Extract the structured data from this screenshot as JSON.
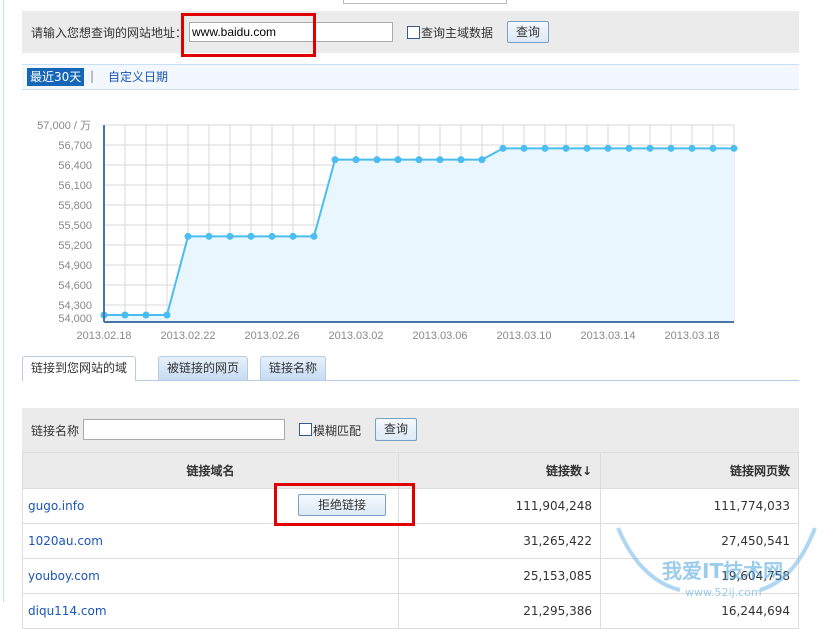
{
  "search": {
    "label": "请输入您想查询的网站地址：",
    "value": "www.baidu.com",
    "checkbox_label": "查询主域数据",
    "button": "查询"
  },
  "date_tabs": {
    "active": "最近30天",
    "separator": "|",
    "custom": "自定义日期"
  },
  "chart_data": {
    "type": "line",
    "title": "",
    "xlabel": "",
    "ylabel": "万",
    "ylim": [
      54000,
      57000
    ],
    "y_ticks": [
      "54,000",
      "54,300",
      "54,600",
      "54,900",
      "55,200",
      "55,500",
      "55,800",
      "56,100",
      "56,400",
      "56,700",
      "57,000 / 万"
    ],
    "x_ticks": [
      "2013.02.18",
      "2013.02.22",
      "2013.02.26",
      "2013.03.02",
      "2013.03.06",
      "2013.03.10",
      "2013.03.14",
      "2013.03.18"
    ],
    "x": [
      "02.18",
      "02.19",
      "02.20",
      "02.21",
      "02.22",
      "02.23",
      "02.24",
      "02.25",
      "02.26",
      "02.27",
      "02.28",
      "03.01",
      "03.02",
      "03.03",
      "03.04",
      "03.05",
      "03.06",
      "03.07",
      "03.08",
      "03.09",
      "03.10",
      "03.11",
      "03.12",
      "03.13",
      "03.14",
      "03.15",
      "03.16",
      "03.17",
      "03.18",
      "03.19",
      "03.20"
    ],
    "values": [
      54150,
      54150,
      54150,
      54150,
      55330,
      55330,
      55330,
      55330,
      55330,
      55330,
      55330,
      56480,
      56480,
      56480,
      56480,
      56480,
      56480,
      56480,
      56480,
      56650,
      56650,
      56650,
      56650,
      56650,
      56650,
      56650,
      56650,
      56650,
      56650,
      56650,
      56650
    ],
    "colors": {
      "line": "#4bbdf0",
      "fill": "#eaf6fd",
      "axis": "#4a73a8",
      "grid": "#d8d8d8"
    }
  },
  "link_tabs": [
    "链接到您网站的域",
    "被链接的网页",
    "链接名称"
  ],
  "filter": {
    "label": "链接名称",
    "value": "",
    "checkbox_label": "模糊匹配",
    "button": "查询"
  },
  "table": {
    "headers": [
      "链接域名",
      "链接数↓",
      "链接网页数"
    ],
    "reject_button": "拒绝链接",
    "rows": [
      {
        "domain": "gugo.info",
        "links": "111,904,248",
        "pages": "111,774,033"
      },
      {
        "domain": "1020au.com",
        "links": "31,265,422",
        "pages": "27,450,541"
      },
      {
        "domain": "youboy.com",
        "links": "25,153,085",
        "pages": "19,604,758"
      },
      {
        "domain": "diqu114.com",
        "links": "21,295,386",
        "pages": "16,244,694"
      }
    ]
  },
  "watermark": {
    "title": "我爱IT技术网",
    "url": "www.52ij.com"
  }
}
